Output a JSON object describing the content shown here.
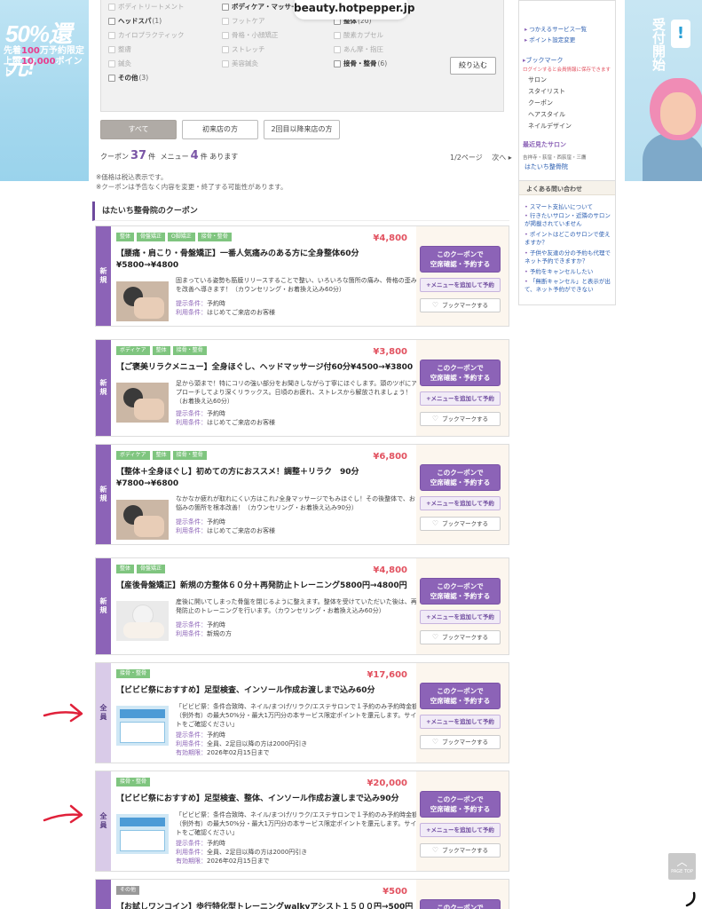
{
  "url": "beauty.hotpepper.jp",
  "banner_left": {
    "pct": "50%還元!",
    "line1a": "先着",
    "line1b": "100",
    "line1c": "万予約限定",
    "line2a": "上限",
    "line2b": "10,000",
    "line2c": "ポイント"
  },
  "banner_right": {
    "text": "受付開始",
    "badge": "!"
  },
  "filter": {
    "rows": [
      [
        {
          "label": "ボディトリートメント",
          "dis": true
        },
        {
          "label": "ボディケア・マッサージ",
          "count": "(10)",
          "bold": true
        },
        {
          "label": "足裏・リフレ",
          "count": "(1)",
          "bold": true
        }
      ],
      [
        {
          "label": "ヘッドスパ",
          "count": "(1)",
          "bold": true
        },
        {
          "label": "フットケア",
          "dis": true
        },
        {
          "label": "整体",
          "count": "(20)",
          "bold": true
        }
      ],
      [
        {
          "label": "カイロプラクティック",
          "dis": true
        },
        {
          "label": "骨格・小顔矯正",
          "dis": true
        },
        {
          "label": "酸素カプセル",
          "dis": true
        }
      ],
      [
        {
          "label": "整膚",
          "dis": true
        },
        {
          "label": "ストレッチ",
          "dis": true
        },
        {
          "label": "あん摩・指圧",
          "dis": true
        }
      ],
      [
        {
          "label": "鍼灸",
          "dis": true
        },
        {
          "label": "美容鍼灸",
          "dis": true
        },
        {
          "label": "接骨・整骨",
          "count": "(6)",
          "bold": true
        }
      ],
      [
        {
          "label": "その他",
          "count": "(3)",
          "bold": true
        }
      ]
    ],
    "refine": "絞り込む"
  },
  "tabs": [
    "すべて",
    "初来店の方",
    "2回目以降来店の方"
  ],
  "counts": {
    "coupon_label": "クーポン",
    "coupon": "37",
    "unit": "件",
    "menu_label": "メニュー",
    "menu": "4",
    "suffix": "件 あります"
  },
  "pager": {
    "page": "1/2ページ",
    "next": "次へ ▸"
  },
  "notes": [
    "※価格は税込表示です。",
    "※クーポンは予告なく内容を変更・終了する可能性があります。"
  ],
  "section_title": "はたいち整骨院のクーポン",
  "buttons": {
    "main1": "このクーポンで",
    "main2": "空席確認・予約する",
    "menu": "+メニューを追加して予約",
    "bookmark": "ブックマークする"
  },
  "cards": [
    {
      "badge": "新規",
      "tags": [
        "整体",
        "骨盤矯正",
        "O脚矯正",
        "接骨・整骨"
      ],
      "price": "¥4,800",
      "title": "【腰痛・肩こり・骨盤矯正】一番人気痛みのある方に全身整体60分",
      "title2": "¥5800→¥4800",
      "desc": "固まっている姿勢も筋膜リリースすることで整い、いろいろな箇所の痛み、骨格の歪みを改善へ導きます！（カウンセリング・お着換え込み60分）",
      "c1k": "提示条件：",
      "c1v": "予約時",
      "c2k": "利用条件：",
      "c2v": "はじめてご来店のお客様"
    },
    {
      "badge": "新規",
      "tags": [
        "ボディケア",
        "整体",
        "接骨・整骨"
      ],
      "price": "¥3,800",
      "title": "【ご褒美リラクメニュー】全身ほぐし、ヘッドマッサージ付60分¥4500→¥3800",
      "title2": "",
      "desc": "足から頭まで！特にコリの強い部分をお聞きしながら丁寧にほぐします。頭のツボにアプローチしてより深くリラックス。日頃のお疲れ、ストレスから解放されましょう！（お着換え込60分）",
      "c1k": "提示条件：",
      "c1v": "予約時",
      "c2k": "利用条件：",
      "c2v": "はじめてご来店のお客様"
    },
    {
      "badge": "新規",
      "tags": [
        "ボディケア",
        "整体",
        "接骨・整骨"
      ],
      "price": "¥6,800",
      "title": "【整体＋全身ほぐし】初めての方におススメ！調整＋リラク　90分",
      "title2": "¥7800→¥6800",
      "desc": "なかなか疲れが取れにくい方はこれ♪全身マッサージでもみほぐし！その後整体で、お悩みの箇所を根本改善！（カウンセリング・お着換え込み90分）",
      "c1k": "提示条件：",
      "c1v": "予約時",
      "c2k": "利用条件：",
      "c2v": "はじめてご来店のお客様"
    },
    {
      "badge": "新規",
      "tags": [
        "整体",
        "骨盤矯正"
      ],
      "price": "¥4,800",
      "title": "【産後骨盤矯正】新規の方整体６０分＋再発防止トレーニング5800円→4800円",
      "title2": "",
      "desc": "産後に開いてしまった骨盤を閉じるように整えます。整体を受けていただいた後は、再発防止のトレーニングを行います。（カウンセリング・お着換え込み60分）",
      "c1k": "提示条件：",
      "c1v": "予約時",
      "c2k": "利用条件：",
      "c2v": "新規の方"
    },
    {
      "badge": "全員",
      "tags": [
        "接骨・整骨"
      ],
      "price": "¥17,600",
      "title": "【ビビビ祭におすすめ】足型検査、インソール作成お渡しまで込み60分",
      "title2": "",
      "desc": "「ビビビ祭：条件合致時、ネイル/まつげ/リラク/エステサロンで１予約のみ予約時金額（例外有）の最大50%分・最大1万円分の本サービス限定ポイントを還元します。サイトをご確認ください」",
      "c1k": "提示条件：",
      "c1v": "予約時",
      "c2k": "利用条件：",
      "c2v": "全員、2足目以降の方は2000円引き",
      "c3k": "有効期限：",
      "c3v": "2026年02月15日まで"
    },
    {
      "badge": "全員",
      "tags": [
        "接骨・整骨"
      ],
      "price": "¥20,000",
      "title": "【ビビビ祭におすすめ】足型検査、整体、インソール作成お渡しまで込み90分",
      "title2": "",
      "desc": "「ビビビ祭：条件合致時、ネイル/まつげ/リラク/エステサロンで１予約のみ予約時金額（例外有）の最大50%分・最大1万円分の本サービス限定ポイントを還元します。サイトをご確認ください」",
      "c1k": "提示条件：",
      "c1v": "予約時",
      "c2k": "利用条件：",
      "c2v": "全員、2足目以降の方は2000円引き",
      "c3k": "有効期限：",
      "c3v": "2026年02月15日まで"
    },
    {
      "badge": "",
      "tags": [
        "その他"
      ],
      "price": "¥500",
      "title": "【お試しワンコイン】歩行特化型トレーニングwalkyアシスト１５００円→500円",
      "title2": ""
    }
  ],
  "sidebar": {
    "links_top": [
      "つかえるサービス一覧",
      "ポイント設定変更"
    ],
    "bookmark_head": "ブックマーク",
    "bookmark_note": "ログインすると会員情報に保存できます",
    "bookmark_items": [
      "サロン",
      "スタイリスト",
      "クーポン",
      "ヘアスタイル",
      "ネイルデザイン"
    ],
    "recent_head": "最近見たサロン",
    "recent_area": "吉祥寺・荻窪・西荻窪・三鷹",
    "recent_salon": "はたいち整骨院",
    "faq_head": "よくある問い合わせ",
    "faq": [
      "スマート支払いについて",
      "行きたいサロン・近隣のサロンが掲載されていません",
      "ポイントはどこのサロンで使えますか？",
      "子供や友達の分の予約も代理でネット予約できますか？",
      "予約をキャンセルしたい",
      "「無断キャンセル」と表示が出て、ネット予約ができない"
    ]
  },
  "pagetop": {
    "chev": "︿",
    "label": "PAGE TOP"
  },
  "colors": {
    "accent": "#8c63b7",
    "price": "#e25260",
    "arrow": "#e0213a"
  }
}
